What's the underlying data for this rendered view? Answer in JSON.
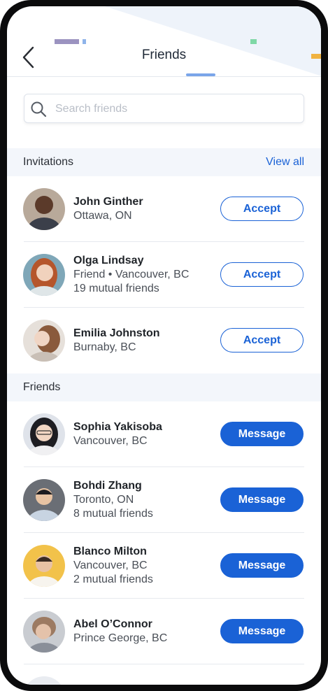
{
  "header": {
    "title": "Friends",
    "back_icon": "chevron-left-icon"
  },
  "search": {
    "placeholder": "Search friends",
    "value": "",
    "icon": "search-icon"
  },
  "invitations": {
    "label": "Invitations",
    "view_all": "View all",
    "items": [
      {
        "name": "John Ginther",
        "line1": "Ottawa, ON",
        "line2": "",
        "action": "Accept"
      },
      {
        "name": "Olga Lindsay",
        "line1": "Friend • Vancouver, BC",
        "line2": "19 mutual friends",
        "action": "Accept"
      },
      {
        "name": "Emilia Johnston",
        "line1": "Burnaby, BC",
        "line2": "",
        "action": "Accept"
      }
    ]
  },
  "friends": {
    "label": "Friends",
    "items": [
      {
        "name": "Sophia Yakisoba",
        "line1": "Vancouver, BC",
        "line2": "",
        "action": "Message"
      },
      {
        "name": "Bohdi Zhang",
        "line1": "Toronto, ON",
        "line2": "8 mutual friends",
        "action": "Message"
      },
      {
        "name": "Blanco Milton",
        "line1": "Vancouver, BC",
        "line2": "2 mutual friends",
        "action": "Message"
      },
      {
        "name": "Abel O’Connor",
        "line1": "Prince George, BC",
        "line2": "",
        "action": "Message"
      }
    ]
  },
  "colors": {
    "accent": "#1a62d6",
    "section_bg": "#f3f6fb",
    "device_frame": "#0b0b0c"
  }
}
